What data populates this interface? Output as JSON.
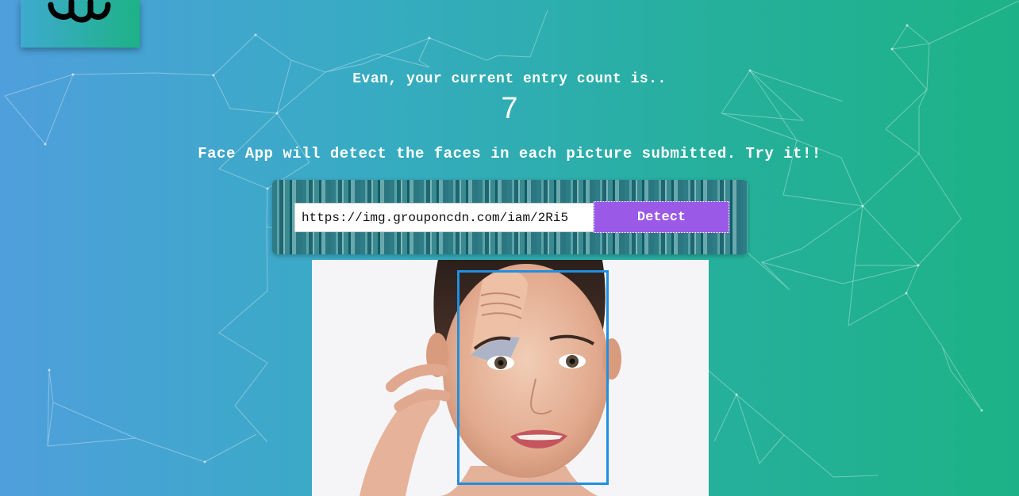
{
  "header": {
    "greeting": "Evan, your current entry count is..",
    "entry_count": "7"
  },
  "tagline": "Face App will detect the faces in each picture submitted. Try it!!",
  "form": {
    "url_value": "https://img.grouponcdn.com/iam/2Ri5",
    "detect_label": "Detect"
  },
  "logo": {
    "icon": "brain-icon"
  },
  "image": {
    "subject": "woman-face-photo",
    "faces_detected": 1
  },
  "colors": {
    "button": "#9b59e8",
    "face_box": "#1f8fe0",
    "gradient_start": "#4f9fdc",
    "gradient_end": "#1db286"
  }
}
